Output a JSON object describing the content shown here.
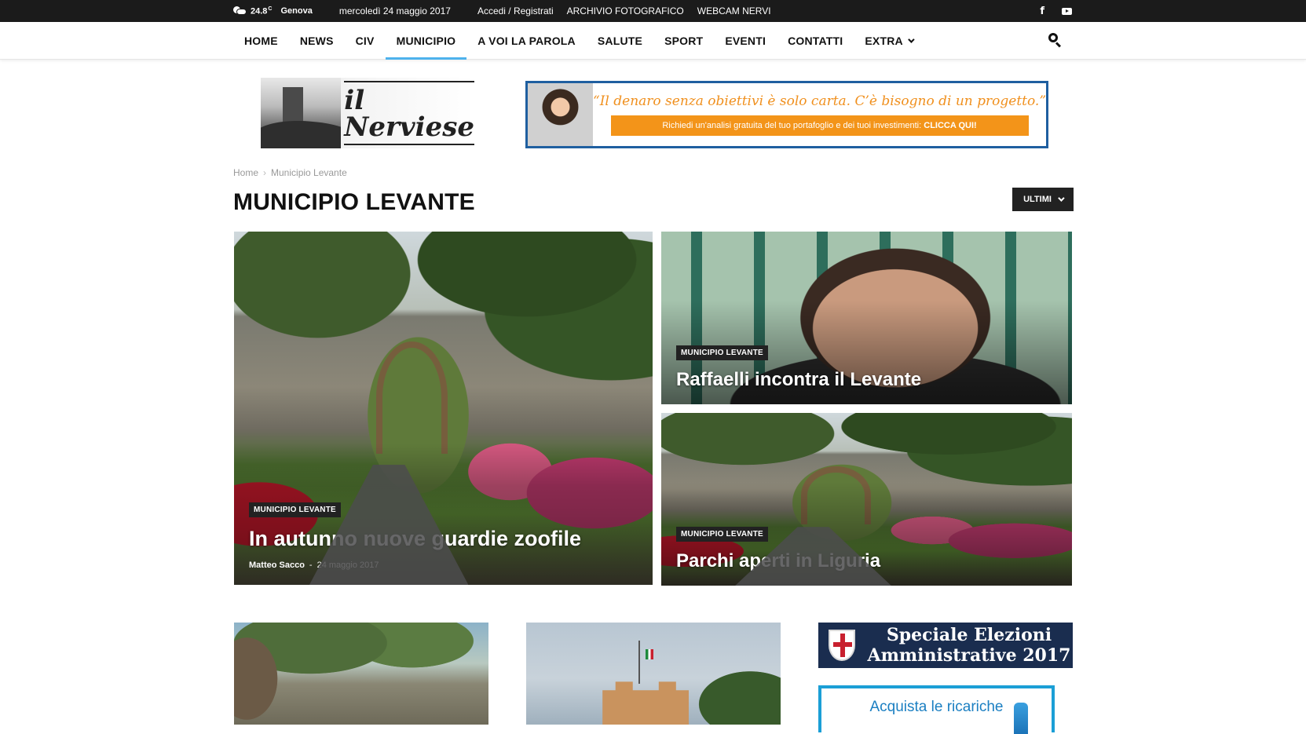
{
  "topbar": {
    "temperature": "24.8",
    "temp_unit": "C",
    "city": "Genova",
    "date": "mercoledì 24 maggio 2017",
    "links": [
      "Accedi / Registrati",
      "ARCHIVIO FOTOGRAFICO",
      "WEBCAM NERVI"
    ],
    "social_facebook": "f"
  },
  "nav": {
    "items": [
      "HOME",
      "NEWS",
      "CIV",
      "MUNICIPIO",
      "A VOI LA PAROLA",
      "SALUTE",
      "SPORT",
      "EVENTI",
      "CONTATTI",
      "EXTRA"
    ],
    "active": "MUNICIPIO"
  },
  "logo": {
    "text": "il Nerviese"
  },
  "ad": {
    "quote": "“Il denaro senza obiettivi è solo carta. C’è bisogno di un progetto.”",
    "cta_text": "Richiedi un'analisi gratuita del tuo portafoglio e dei tuoi investimenti:",
    "cta_link": "CLICCA QUI!"
  },
  "breadcrumb": {
    "home": "Home",
    "separator": "›",
    "current": "Municipio Levante"
  },
  "page_title": "MUNICIPIO LEVANTE",
  "sort_button": "ULTIMI",
  "featured": [
    {
      "category": "MUNICIPIO LEVANTE",
      "title": "In autunno nuove guardie zoofile",
      "author": "Matteo Sacco",
      "separator": "-",
      "date": "24 maggio 2017"
    },
    {
      "category": "MUNICIPIO LEVANTE",
      "title": "Raffaelli incontra il Levante"
    },
    {
      "category": "MUNICIPIO LEVANTE",
      "title": "Parchi aperti in Liguria"
    }
  ],
  "sidebar": {
    "elezioni_line1": "Speciale Elezioni",
    "elezioni_line2": "Amministrative 2017",
    "ricariche_line1": "Acquista le ricariche"
  },
  "colors": {
    "topbar_bg": "#1b1b1b",
    "nav_active_underline": "#4db2ec",
    "ad_border": "#1f5fa0",
    "ad_cta": "#f39419",
    "elezioni_bg": "#1a2d4f",
    "ricariche_border": "#1b9fd6"
  }
}
